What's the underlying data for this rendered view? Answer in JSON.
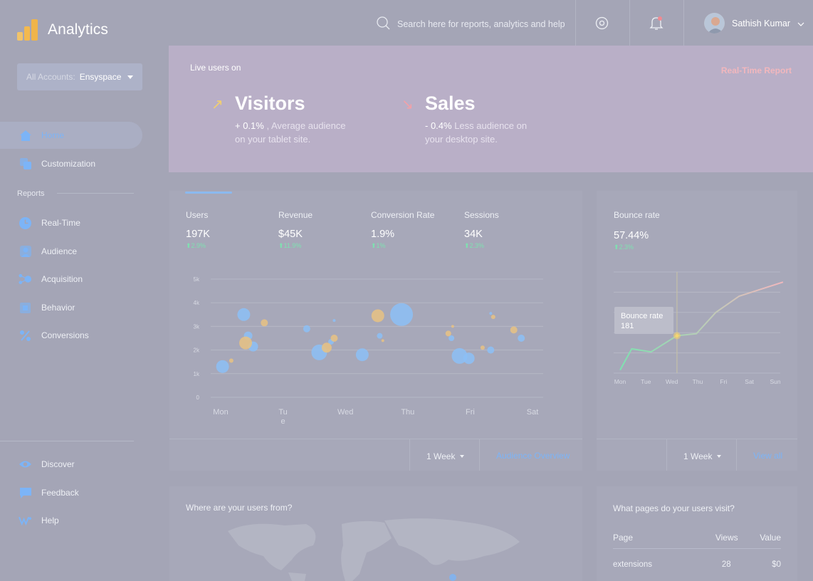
{
  "app": {
    "title": "Analytics"
  },
  "account": {
    "label": "All Accounts:",
    "value": "Ensyspace"
  },
  "nav": {
    "home": "Home",
    "customization": "Customization",
    "reports_label": "Reports",
    "realtime": "Real-Time",
    "audience": "Audience",
    "acquisition": "Acquisition",
    "behavior": "Behavior",
    "conversions": "Conversions",
    "discover": "Discover",
    "feedback": "Feedback",
    "help": "Help"
  },
  "search": {
    "placeholder": "Search here for reports, analytics and help"
  },
  "user": {
    "name": "Sathish Kumar"
  },
  "banner": {
    "live_label": "Live users on",
    "realtime_link": "Real-Time Report",
    "visitors": {
      "title": "Visitors",
      "value": "+ 0.1%",
      "text": " , Average audience on your tablet site."
    },
    "sales": {
      "title": "Sales",
      "value": "- 0.4%",
      "text": " Less audience on your desktop site."
    }
  },
  "metrics": [
    {
      "label": "Users",
      "value": "197K",
      "change": "2.9%"
    },
    {
      "label": "Revenue",
      "value": "$45K",
      "change": "11.9%"
    },
    {
      "label": "Conversion Rate",
      "value": "1.9%",
      "change": "1%"
    },
    {
      "label": "Sessions",
      "value": "34K",
      "change": "2.3%"
    }
  ],
  "audience_footer": {
    "range": "1 Week",
    "link": "Audience Overview"
  },
  "bounce": {
    "label": "Bounce rate",
    "value": "57.44%",
    "change": "2.3%",
    "tooltip_label": "Bounce rate",
    "tooltip_value": "181",
    "range": "1 Week",
    "link": "View all"
  },
  "where_title": "Where are your users from?",
  "pages_card": {
    "title": "What pages do your users visit?",
    "headers": [
      "Page",
      "Views",
      "Value"
    ],
    "rows": [
      [
        "extensions",
        "28",
        "$0"
      ]
    ]
  },
  "colors": {
    "blue": "#8cc0f6",
    "yellow": "#e7c283",
    "green": "#7ee2b0",
    "pink": "#f2b7bd"
  },
  "chart_data": [
    {
      "type": "scatter",
      "title": "",
      "x_categories": [
        "Mon",
        "Tue",
        "Wed",
        "Thu",
        "Fri",
        "Sat"
      ],
      "x_tick_labels": [
        "Mon",
        "Tu\ne",
        "Wed",
        "Thu",
        "Fri",
        "Sat"
      ],
      "y_ticks": [
        "0",
        "1k",
        "2k",
        "3k",
        "4k",
        "5k"
      ],
      "ylim": [
        0,
        5000
      ],
      "series": [
        {
          "color": "blue",
          "points": [
            {
              "x": 0.03,
              "y": 1300,
              "r": 9
            },
            {
              "x": 0.37,
              "y": 3500,
              "r": 9
            },
            {
              "x": 0.44,
              "y": 2600,
              "r": 6
            },
            {
              "x": 0.52,
              "y": 2150,
              "r": 7
            },
            {
              "x": 1.38,
              "y": 2900,
              "r": 5
            },
            {
              "x": 1.58,
              "y": 1900,
              "r": 11
            },
            {
              "x": 1.77,
              "y": 2350,
              "r": 4
            },
            {
              "x": 1.82,
              "y": 3250,
              "r": 2
            },
            {
              "x": 2.27,
              "y": 1800,
              "r": 9
            },
            {
              "x": 2.55,
              "y": 2600,
              "r": 4
            },
            {
              "x": 2.9,
              "y": 3500,
              "r": 16
            },
            {
              "x": 3.7,
              "y": 2500,
              "r": 4
            },
            {
              "x": 3.83,
              "y": 1750,
              "r": 11
            },
            {
              "x": 3.98,
              "y": 1650,
              "r": 8
            },
            {
              "x": 4.33,
              "y": 2000,
              "r": 5
            },
            {
              "x": 4.33,
              "y": 3550,
              "r": 2
            },
            {
              "x": 4.82,
              "y": 2500,
              "r": 5
            }
          ]
        },
        {
          "color": "yellow",
          "points": [
            {
              "x": 0.17,
              "y": 1550,
              "r": 3
            },
            {
              "x": 0.4,
              "y": 2300,
              "r": 9
            },
            {
              "x": 0.7,
              "y": 3150,
              "r": 5
            },
            {
              "x": 1.7,
              "y": 2100,
              "r": 7
            },
            {
              "x": 1.82,
              "y": 2500,
              "r": 5
            },
            {
              "x": 2.52,
              "y": 3450,
              "r": 9
            },
            {
              "x": 2.6,
              "y": 2400,
              "r": 2
            },
            {
              "x": 3.65,
              "y": 2700,
              "r": 4
            },
            {
              "x": 3.72,
              "y": 3000,
              "r": 2
            },
            {
              "x": 4.2,
              "y": 2100,
              "r": 3
            },
            {
              "x": 4.37,
              "y": 3400,
              "r": 3
            },
            {
              "x": 4.7,
              "y": 2850,
              "r": 5
            }
          ]
        }
      ]
    },
    {
      "type": "line",
      "title": "Bounce rate",
      "categories": [
        "Mon",
        "Tue",
        "Wed",
        "Thu",
        "Fri",
        "Sat",
        "Sun"
      ],
      "x": [
        0,
        0.45,
        1.2,
        2.2,
        2.95,
        3.7,
        4.6,
        6.3
      ],
      "values": [
        0.15,
        1.2,
        1.05,
        1.85,
        1.95,
        3.0,
        3.8,
        4.5
      ],
      "highlight": {
        "x": 2.2,
        "label": "Bounce rate",
        "value": "181"
      }
    }
  ]
}
